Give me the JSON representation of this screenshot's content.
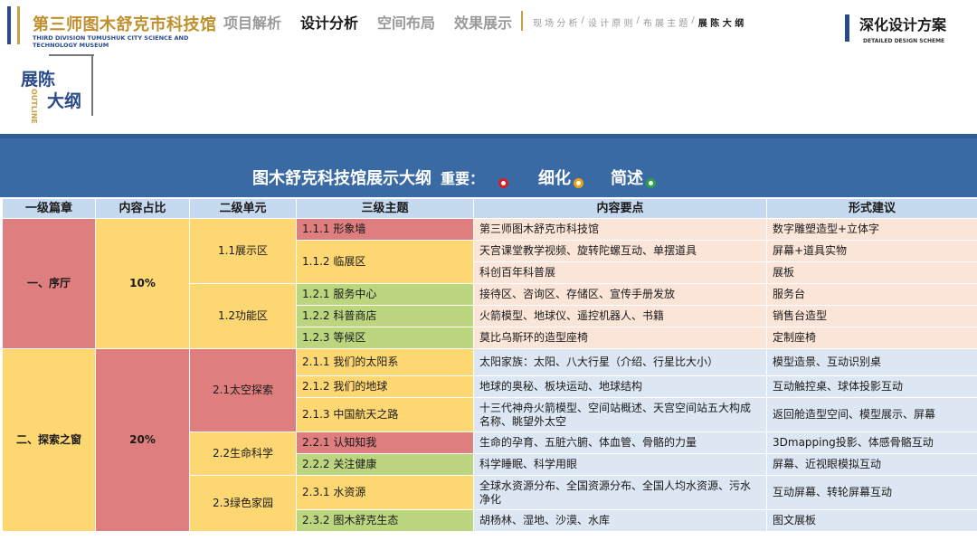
{
  "header": {
    "logo_cn": "第三师图木舒克市科技馆",
    "logo_en_line1": "THIRD DIVISION TUMUSHUK CITY SCIENCE AND",
    "logo_en_line2": "TECHNOLOGY MUSEUM",
    "nav": [
      {
        "label": "项目解析",
        "active": false
      },
      {
        "label": "设计分析",
        "active": true
      },
      {
        "label": "空间布局",
        "active": false
      },
      {
        "label": "效果展示",
        "active": false
      }
    ],
    "sub_nav": [
      {
        "label": "现 场 分 析",
        "current": false
      },
      {
        "label": "设 计 原 则",
        "current": false
      },
      {
        "label": "布 展 主 题",
        "current": false
      },
      {
        "label": "展 陈 大 纲",
        "current": true
      }
    ],
    "sub_nav_separator": "/",
    "right_title": "深化设计方案",
    "right_subtitle": "DETAILED DESIGN SCHEME"
  },
  "section_tag": {
    "title_line1": "展陈",
    "title_line2": "大纲",
    "vertical_en": "OUTLINE"
  },
  "banner": {
    "title": "图木舒克科技馆展示大纲",
    "importance_label": "重要：",
    "legend": [
      {
        "label": "",
        "color": "#d61e2a"
      },
      {
        "label": "细化",
        "color": "#e8a317"
      },
      {
        "label": "简述",
        "color": "#2aa04a"
      }
    ]
  },
  "table": {
    "headers": [
      "一级篇章",
      "内容占比",
      "二级单元",
      "三级主题",
      "内容要点",
      "形式建议"
    ],
    "chapters": [
      {
        "name": "一、序厅",
        "ratio": "10%",
        "units": [
          {
            "name": "1.1展示区",
            "rows": [
              {
                "topic": "1.1.1 形象墙",
                "content": "第三师图木舒克市科技馆",
                "form": "数字雕塑造型+立体字"
              },
              {
                "topic": "1.1.2 临展区",
                "content": "天宫课堂教学视频、旋转陀螺互动、单摆道具",
                "form": "屏幕+道具实物"
              },
              {
                "topic": "",
                "content": "科创百年科普展",
                "form": "展板"
              }
            ]
          },
          {
            "name": "1.2功能区",
            "rows": [
              {
                "topic": "1.2.1 服务中心",
                "content": "接待区、咨询区、存储区、宣传手册发放",
                "form": "服务台"
              },
              {
                "topic": "1.2.2 科普商店",
                "content": "火箭模型、地球仪、遥控机器人、书籍",
                "form": "销售台造型"
              },
              {
                "topic": "1.2.3 等候区",
                "content": "莫比乌斯环的造型座椅",
                "form": "定制座椅"
              }
            ]
          }
        ]
      },
      {
        "name": "二、探索之窗",
        "ratio": "20%",
        "units": [
          {
            "name": "2.1太空探索",
            "rows": [
              {
                "topic": "2.1.1 我们的太阳系",
                "content": "太阳家族：太阳、八大行星（介绍、行星比大小）",
                "form": "模型造景、互动识别桌"
              },
              {
                "topic": "2.1.2 我们的地球",
                "content": "地球的奥秘、板块运动、地球结构",
                "form": "互动触控桌、球体投影互动"
              },
              {
                "topic": "2.1.3 中国航天之路",
                "content": "十三代神舟火箭模型、空间站概述、天宫空间站五大构成名称、眺望外太空",
                "form": "返回舱造型空间、模型展示、屏幕"
              }
            ]
          },
          {
            "name": "2.2生命科学",
            "rows": [
              {
                "topic": "2.2.1 认知知我",
                "content": "生命的孕育、五脏六腑、体血管、骨骼的力量",
                "form": "3Dmapping投影、体感骨骼互动"
              },
              {
                "topic": "2.2.2 关注健康",
                "content": "科学睡眠、科学用眼",
                "form": "屏幕、近视眼模拟互动"
              }
            ]
          },
          {
            "name": "2.3绿色家园",
            "rows": [
              {
                "topic": "2.3.1 水资源",
                "content": "全球水资源分布、全国资源分布、全国人均水资源、污水净化",
                "form": "互动屏幕、转轮屏幕互动"
              },
              {
                "topic": "2.3.2 图木舒克生态",
                "content": "胡杨林、湿地、沙漠、水库",
                "form": "图文展板"
              }
            ]
          }
        ]
      }
    ]
  }
}
